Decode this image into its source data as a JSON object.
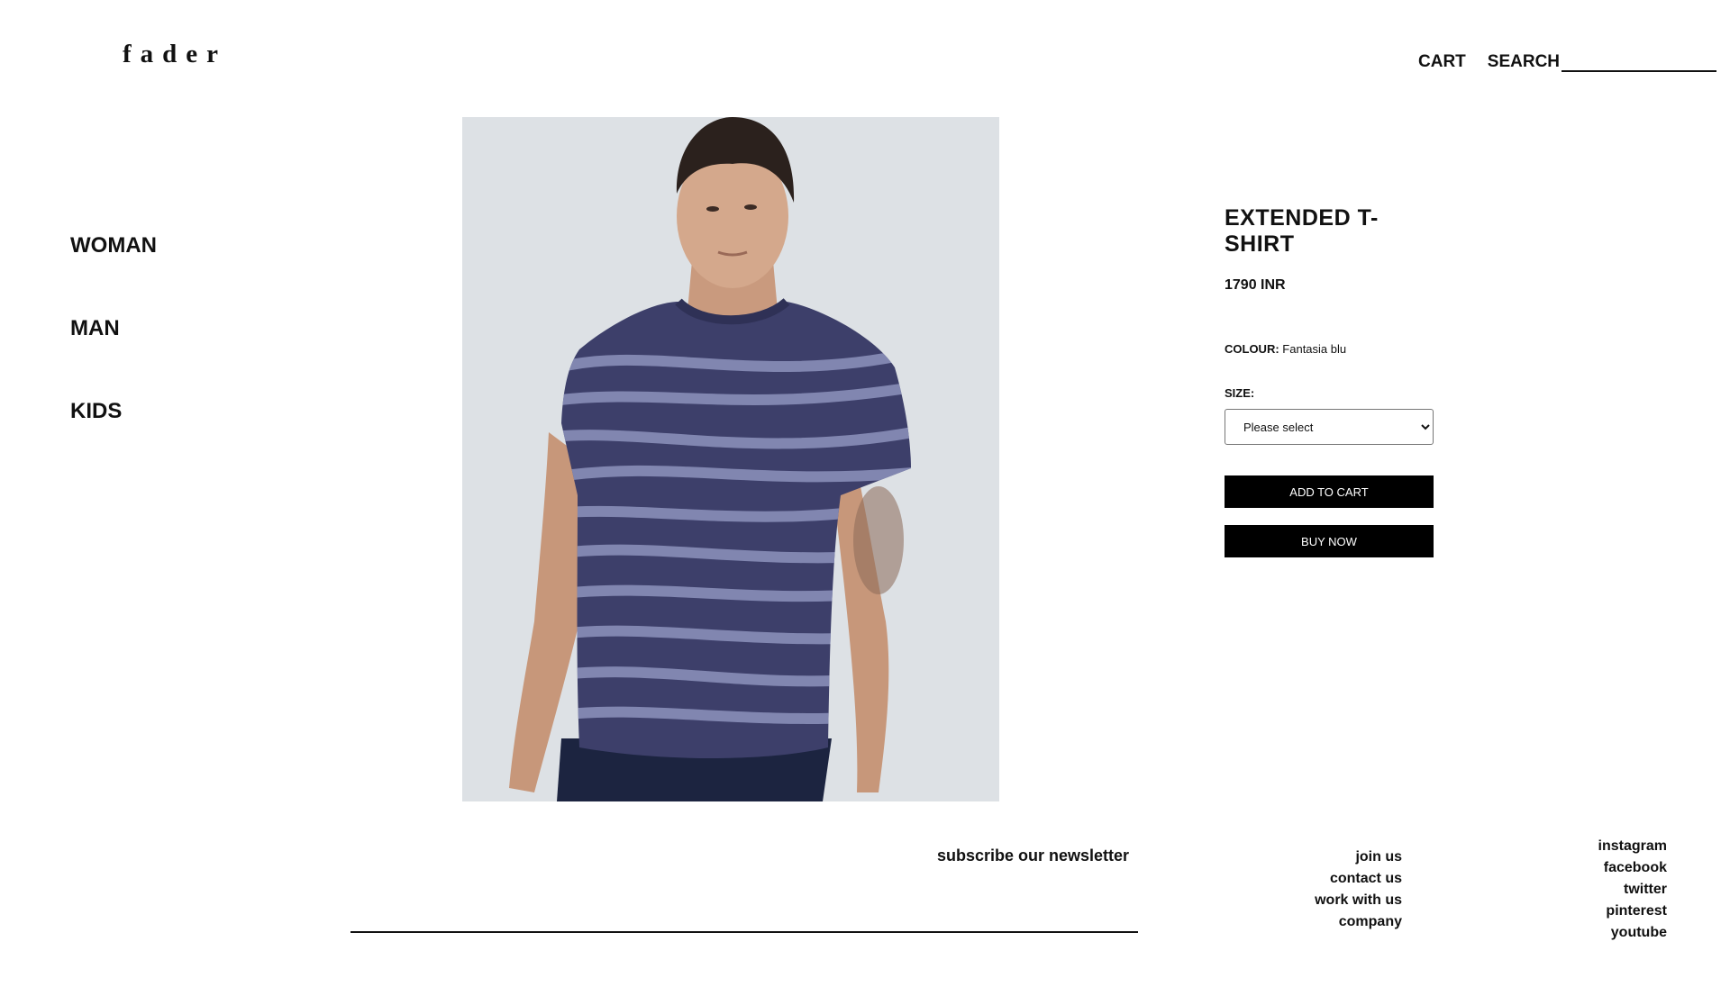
{
  "brand": {
    "logo": "fader"
  },
  "header": {
    "cart_label": "CART",
    "search_label": "SEARCH"
  },
  "sidebar": {
    "items": [
      {
        "label": "WOMAN"
      },
      {
        "label": "MAN"
      },
      {
        "label": "KIDS"
      }
    ]
  },
  "product": {
    "image_icon": "product-photo",
    "name": "EXTENDED T-SHIRT",
    "price": "1790 INR",
    "colour_label": "COLOUR:",
    "colour_value": "Fantasia blu",
    "size_label": "SIZE:",
    "size_select_value": "Please select",
    "add_to_cart_label": "ADD TO CART",
    "buy_now_label": "BUY NOW"
  },
  "footer": {
    "newsletter_title": "subscribe our newsletter",
    "links": [
      {
        "label": "join us"
      },
      {
        "label": "contact us"
      },
      {
        "label": "work with us"
      },
      {
        "label": "company"
      }
    ],
    "social": [
      {
        "label": "instagram"
      },
      {
        "label": "facebook"
      },
      {
        "label": "twitter"
      },
      {
        "label": "pinterest"
      },
      {
        "label": "youtube"
      }
    ]
  },
  "colors": {
    "button_bg": "#000000",
    "button_text": "#ffffff",
    "shirt": "#3d3f6a",
    "stripes": "#8d93bd"
  }
}
